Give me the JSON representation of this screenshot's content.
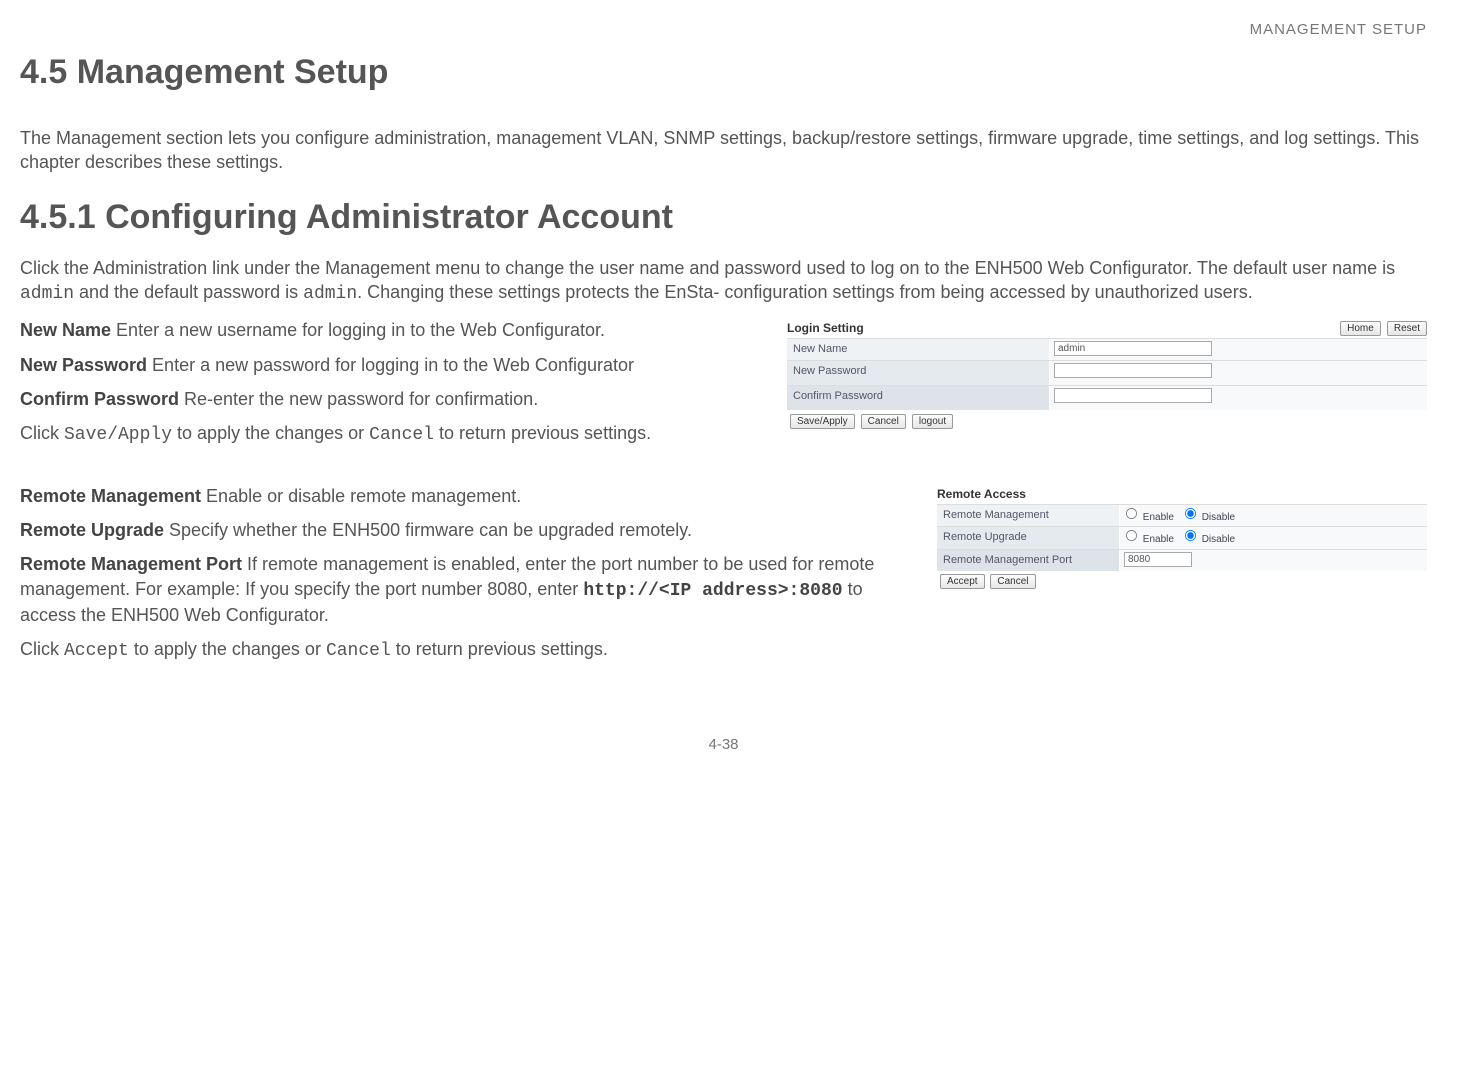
{
  "header": {
    "section": "MANAGEMENT SETUP"
  },
  "h1": "4.5 Management Setup",
  "intro": "The Management section lets you configure administration, management VLAN, SNMP settings, backup/restore settings, firmware upgrade, time settings, and log settings. This chapter describes these settings.",
  "h2": "4.5.1 Configuring Administrator Account",
  "config_para_a": "Click the Administration link under the Management menu to change the user name and password used to log on to the ENH500 Web Configurator. The default user name is ",
  "config_admin1": "admin",
  "config_para_b": " and the default password is ",
  "config_admin2": "admin",
  "config_para_c": ". Changing these settings protects the EnSta- configuration settings from being accessed by unauthorized users.",
  "fields": {
    "new_name_label": "New Name",
    "new_name_desc": "  Enter a new username for logging in to the Web Configurator.",
    "new_pw_label": "New Password",
    "new_pw_desc": "  Enter a new password for logging in to the Web Configurator",
    "confirm_pw_label": "Confirm Password",
    "confirm_pw_desc": "  Re-enter the new password for confirmation."
  },
  "save_line_a": "Click ",
  "save_apply": "Save/Apply",
  "save_line_b": " to apply the changes or ",
  "cancel": "Cancel",
  "save_line_c": " to return previous settings.",
  "remote": {
    "rm_label": "Remote Management",
    "rm_desc": "  Enable or disable remote management.",
    "ru_label": "Remote Upgrade",
    "ru_desc": "  Specify whether the ENH500 firmware can be upgraded remotely.",
    "rmp_label": "Remote Management Port",
    "rmp_desc": "  If remote management is enabled, enter the port number to be used for remote management. For example: If you specify the port number 8080, enter ",
    "rmp_code": "http://<IP address>:8080",
    "rmp_desc2": " to access the ENH500 Web Configurator."
  },
  "accept_line_a": "Click ",
  "accept": "Accept",
  "accept_line_b": " to apply the changes or ",
  "accept_cancel": "Cancel",
  "accept_line_c": " to return previous settings.",
  "footer": "4-38",
  "screenshot1": {
    "title": "Login Setting",
    "btn_home": "Home",
    "btn_reset": "Reset",
    "row1": "New Name",
    "row1_val": "admin",
    "row2": "New Password",
    "row3": "Confirm Password",
    "b_save": "Save/Apply",
    "b_cancel": "Cancel",
    "b_logout": "logout"
  },
  "screenshot2": {
    "title": "Remote Access",
    "row1": "Remote Management",
    "row2": "Remote Upgrade",
    "row3": "Remote Management Port",
    "row3_val": "8080",
    "enable": "Enable",
    "disable": "Disable",
    "b_accept": "Accept",
    "b_cancel": "Cancel"
  }
}
